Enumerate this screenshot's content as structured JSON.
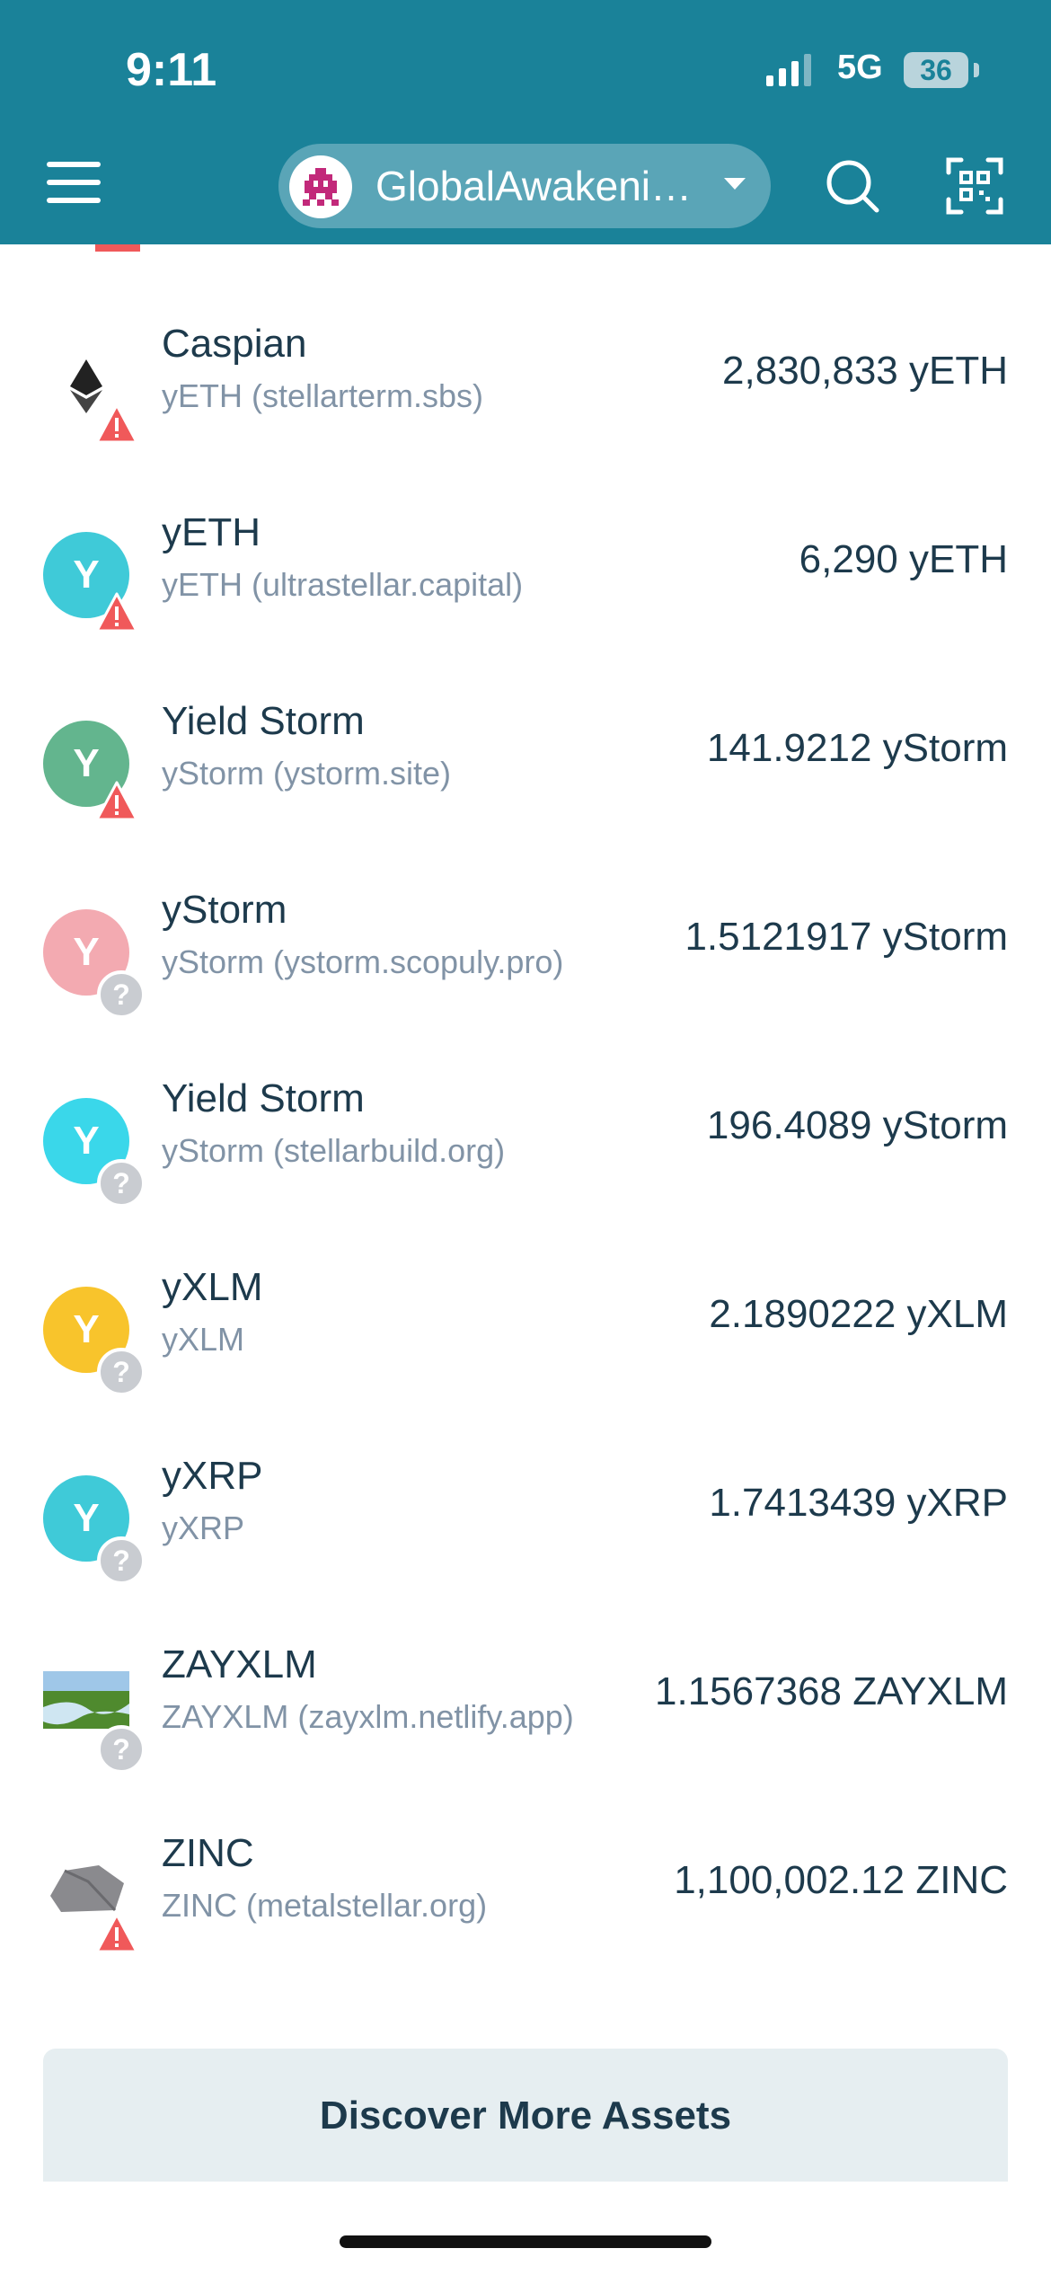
{
  "status_bar": {
    "time": "9:11",
    "network": "5G",
    "battery": "36"
  },
  "header": {
    "account_name": "GlobalAwakeni…"
  },
  "assets": [
    {
      "name": "Caspian",
      "code": "yETH (stellarterm.sbs)",
      "amount": "2,830,833 yETH",
      "icon": "ethereum-icon",
      "icon_letter": "",
      "icon_color": "",
      "flag": "warning"
    },
    {
      "name": "yETH",
      "code": "yETH (ultrastellar.capital)",
      "amount": "6,290 yETH",
      "icon": "letter",
      "icon_letter": "Y",
      "icon_color": "#3fcad8",
      "flag": "warning"
    },
    {
      "name": "Yield Storm",
      "code": "yStorm (ystorm.site)",
      "amount": "141.9212 yStorm",
      "icon": "letter",
      "icon_letter": "Y",
      "icon_color": "#63b58e",
      "flag": "warning"
    },
    {
      "name": "yStorm",
      "code": "yStorm (ystorm.scopuly.pro)",
      "amount": "1.5121917 yStorm",
      "icon": "letter",
      "icon_letter": "Y",
      "icon_color": "#f3aab1",
      "flag": "unknown"
    },
    {
      "name": "Yield Storm",
      "code": "yStorm (stellarbuild.org)",
      "amount": "196.4089 yStorm",
      "icon": "letter",
      "icon_letter": "Y",
      "icon_color": "#3ad7ea",
      "flag": "unknown"
    },
    {
      "name": "yXLM",
      "code": "yXLM",
      "amount": "2.1890222 yXLM",
      "icon": "letter",
      "icon_letter": "Y",
      "icon_color": "#f8c42c",
      "flag": "unknown"
    },
    {
      "name": "yXRP",
      "code": "yXRP",
      "amount": "1.7413439 yXRP",
      "icon": "letter",
      "icon_letter": "Y",
      "icon_color": "#3fcad8",
      "flag": "unknown"
    },
    {
      "name": "ZAYXLM",
      "code": "ZAYXLM (zayxlm.netlify.app)",
      "amount": "1.1567368 ZAYXLM",
      "icon": "landscape-image-icon",
      "icon_letter": "",
      "icon_color": "",
      "flag": "unknown"
    },
    {
      "name": "ZINC",
      "code": "ZINC (metalstellar.org)",
      "amount": "1,100,002.12 ZINC",
      "icon": "rock-image-icon",
      "icon_letter": "",
      "icon_color": "",
      "flag": "warning"
    }
  ],
  "discover_label": "Discover More Assets",
  "colors": {
    "header_bg": "#1a8299",
    "warning": "#f0595a",
    "text": "#1d3a4c",
    "subtext": "#8193a6"
  }
}
